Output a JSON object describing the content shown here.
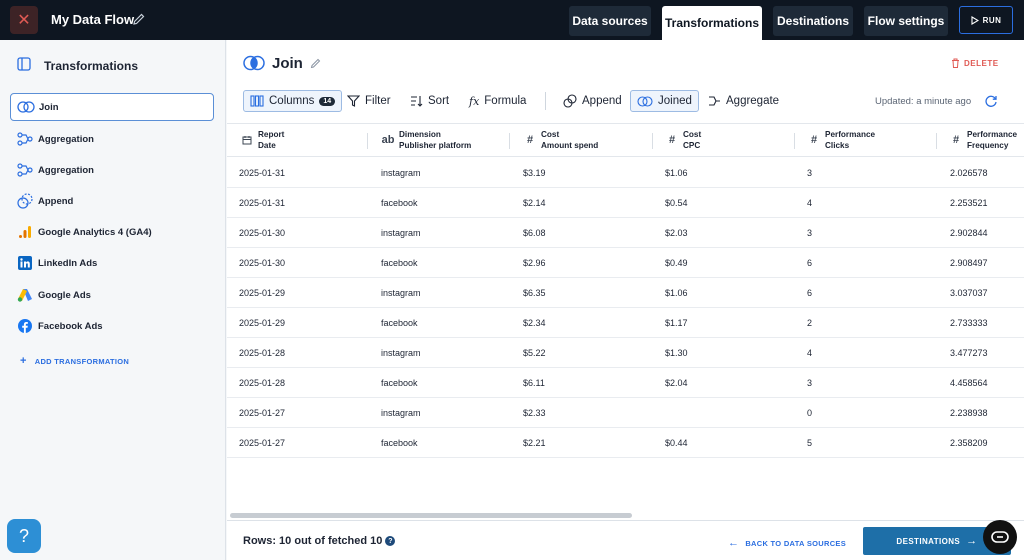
{
  "topbar": {
    "title": "My Data Flow",
    "tabs": [
      {
        "label": "Data sources"
      },
      {
        "label": "Transformations"
      },
      {
        "label": "Destinations"
      },
      {
        "label": "Flow settings"
      }
    ],
    "run_label": "RUN"
  },
  "sidebar": {
    "title": "Transformations",
    "items": [
      {
        "label": "Join",
        "icon": "join-icon"
      },
      {
        "label": "Aggregation",
        "icon": "aggregation-icon"
      },
      {
        "label": "Aggregation",
        "icon": "aggregation-icon"
      },
      {
        "label": "Append",
        "icon": "append-icon"
      },
      {
        "label": "Google Analytics 4 (GA4)",
        "icon": "ga4-icon"
      },
      {
        "label": "LinkedIn Ads",
        "icon": "linkedin-icon"
      },
      {
        "label": "Google Ads",
        "icon": "google-ads-icon"
      },
      {
        "label": "Facebook Ads",
        "icon": "facebook-icon"
      }
    ],
    "add_label": "ADD TRANSFORMATION",
    "help_label": "?"
  },
  "main": {
    "title": "Join",
    "delete_label": "DELETE",
    "toolbar": {
      "columns_label": "Columns",
      "columns_count": "14",
      "filter_label": "Filter",
      "sort_label": "Sort",
      "formula_label": "Formula",
      "append_label": "Append",
      "joined_label": "Joined",
      "aggregate_label": "Aggregate",
      "updated": "Updated: a minute ago"
    },
    "columns": [
      {
        "line1": "Report",
        "line2": "Date",
        "icon": "calendar-icon"
      },
      {
        "line1": "Dimension",
        "line2": "Publisher platform",
        "icon": "ab"
      },
      {
        "line1": "Cost",
        "line2": "Amount spend",
        "icon": "#"
      },
      {
        "line1": "Cost",
        "line2": "CPC",
        "icon": "#"
      },
      {
        "line1": "Performance",
        "line2": "Clicks",
        "icon": "#"
      },
      {
        "line1": "Performance",
        "line2": "Frequency",
        "icon": "#"
      }
    ],
    "rows": [
      [
        "2025-01-31",
        "instagram",
        "$3.19",
        "$1.06",
        "3",
        "2.026578"
      ],
      [
        "2025-01-31",
        "facebook",
        "$2.14",
        "$0.54",
        "4",
        "2.253521"
      ],
      [
        "2025-01-30",
        "instagram",
        "$6.08",
        "$2.03",
        "3",
        "2.902844"
      ],
      [
        "2025-01-30",
        "facebook",
        "$2.96",
        "$0.49",
        "6",
        "2.908497"
      ],
      [
        "2025-01-29",
        "instagram",
        "$6.35",
        "$1.06",
        "6",
        "3.037037"
      ],
      [
        "2025-01-29",
        "facebook",
        "$2.34",
        "$1.17",
        "2",
        "2.733333"
      ],
      [
        "2025-01-28",
        "instagram",
        "$5.22",
        "$1.30",
        "4",
        "3.477273"
      ],
      [
        "2025-01-28",
        "facebook",
        "$6.11",
        "$2.04",
        "3",
        "4.458564"
      ],
      [
        "2025-01-27",
        "instagram",
        "$2.33",
        "",
        "0",
        "2.238938"
      ],
      [
        "2025-01-27",
        "facebook",
        "$2.21",
        "$0.44",
        "5",
        "2.358209"
      ]
    ]
  },
  "footer": {
    "rows_info": "Rows: 10 out of fetched 10",
    "back_label": "BACK TO DATA SOURCES",
    "destinations_label": "DESTINATIONS"
  },
  "colors": {
    "topbar": "#0e1621",
    "accent": "#2b6ee0",
    "danger": "#e05a54",
    "primary_button": "#1e6fa8"
  }
}
